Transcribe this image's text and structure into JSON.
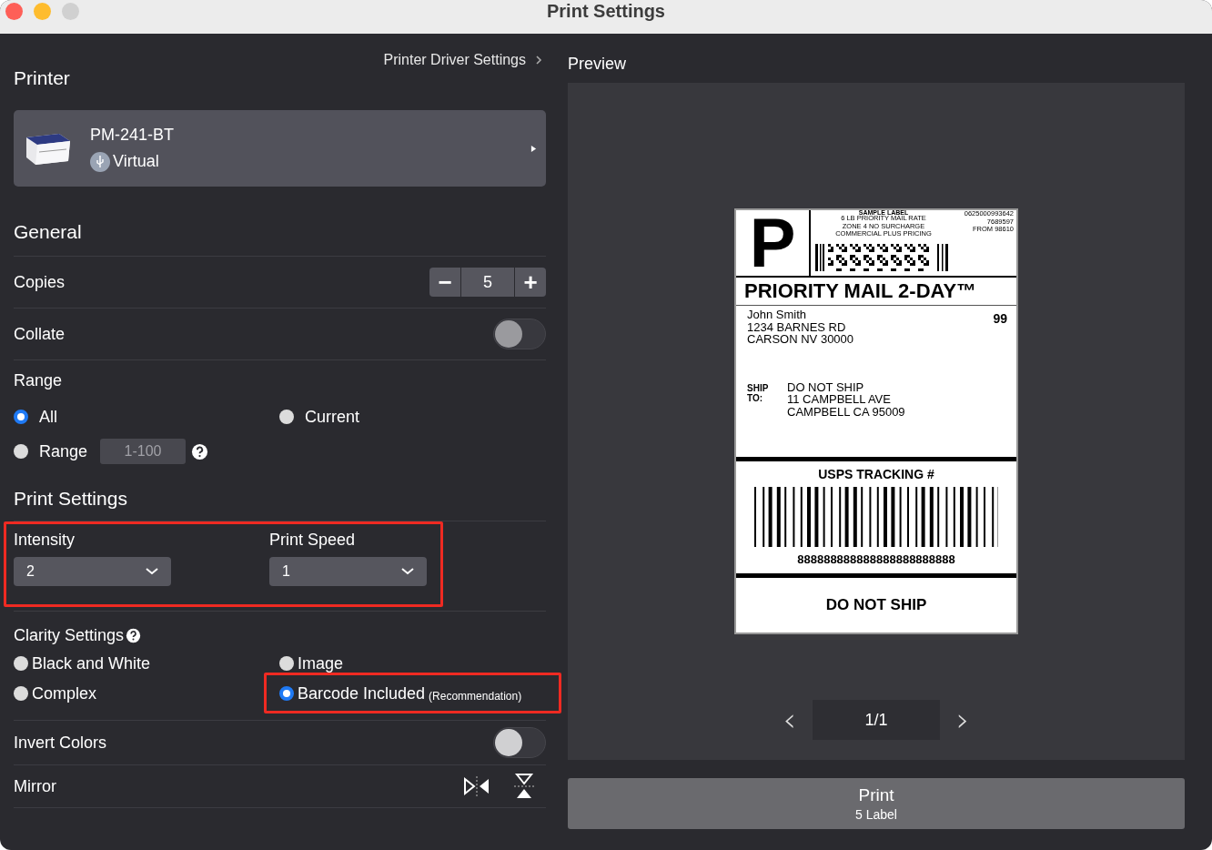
{
  "window": {
    "title": "Print Settings"
  },
  "driver_link": "Printer Driver Settings",
  "printer": {
    "heading": "Printer",
    "name": "PM-241-BT",
    "connection": "Virtual"
  },
  "general": {
    "heading": "General",
    "copies": {
      "label": "Copies",
      "minus": "−",
      "value": "5",
      "plus": "+"
    },
    "collate": {
      "label": "Collate",
      "on": false
    },
    "range": {
      "label": "Range",
      "options": [
        {
          "label": "All",
          "selected": true
        },
        {
          "label": "Current",
          "selected": false
        },
        {
          "label": "Range",
          "selected": false
        }
      ],
      "placeholder": "1-100"
    }
  },
  "print_settings": {
    "heading": "Print Settings",
    "highlighted": true,
    "selects": [
      {
        "label": "Intensity",
        "value": "2"
      },
      {
        "label": "Print Speed",
        "value": "1"
      }
    ],
    "clarity": {
      "label": "Clarity Settings",
      "options": [
        {
          "label": "Black and White",
          "selected": false,
          "highlighted": false
        },
        {
          "label": "Image",
          "selected": false,
          "highlighted": false
        },
        {
          "label": "Complex",
          "selected": false,
          "highlighted": false
        },
        {
          "label": "Barcode Included",
          "note": "(Recommendation)",
          "selected": true,
          "highlighted": true
        }
      ]
    },
    "invert": {
      "label": "Invert Colors",
      "on": false
    },
    "mirror": {
      "label": "Mirror"
    }
  },
  "preview": {
    "heading": "Preview",
    "label": {
      "big_letter": "P",
      "sample": "SAMPLE LABEL",
      "rate_lines": [
        "6 LB PRIORITY MAIL RATE",
        "ZONE 4 NO SURCHARGE",
        "COMMERCIAL PLUS PRICING"
      ],
      "ref_lines": [
        "0625000993642",
        "7689597",
        "FROM 98610"
      ],
      "service": "PRIORITY MAIL 2-DAY™",
      "sender_lines": [
        "John Smith",
        "1234 BARNES RD",
        "CARSON NV 30000"
      ],
      "code": "99",
      "ship_to": "SHIP TO:",
      "recipient_lines": [
        "DO NOT SHIP",
        "11 CAMPBELL AVE",
        "CAMPBELL CA 95009"
      ],
      "tracking_heading": "USPS TRACKING #",
      "tracking_number": "888888888888888888888888",
      "footer": "DO NOT SHIP"
    },
    "prev": "‹",
    "page": "1/1",
    "next": "›"
  },
  "print_button": {
    "label": "Print",
    "sub": "5 Label"
  }
}
